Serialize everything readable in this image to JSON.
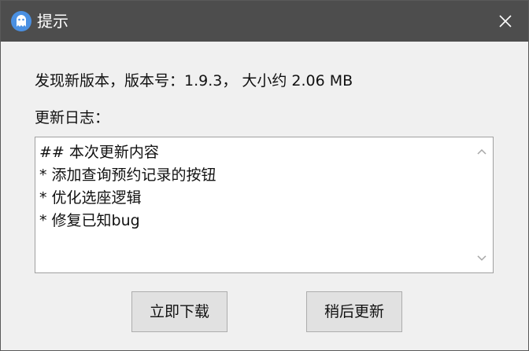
{
  "window": {
    "title": "提示"
  },
  "content": {
    "version_info": "发现新版本，版本号：1.9.3， 大小约 2.06 MB",
    "log_label": "更新日志：",
    "log_lines": [
      "## 本次更新内容",
      "* 添加查询预约记录的按钮",
      "* 优化选座逻辑",
      "* 修复已知bug"
    ]
  },
  "buttons": {
    "download_label": "立即下载",
    "later_label": "稍后更新"
  },
  "icons": {
    "app": "ghost-icon",
    "close": "close-icon",
    "scroll_up": "chevron-up-icon",
    "scroll_down": "chevron-down-icon"
  },
  "colors": {
    "titlebar": "#4d4d4d",
    "app_icon": "#4a90e2",
    "background": "#f0f0f0",
    "button": "#e1e1e1"
  }
}
